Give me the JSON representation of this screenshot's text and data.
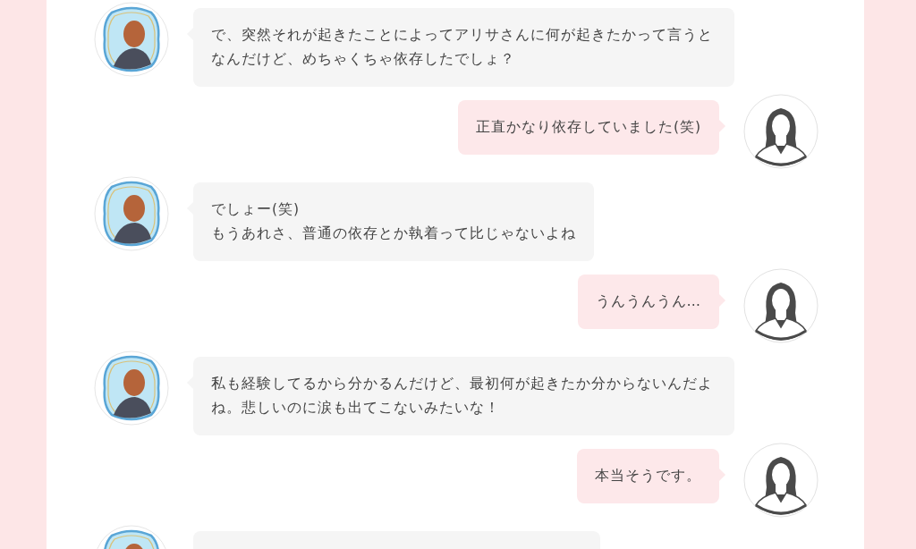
{
  "messages": [
    {
      "kind": "incoming",
      "text": "で、突然それが起きたことによってアリサさんに何が起きたかって言うとなんだけど、めちゃくちゃ依存したでしょ？"
    },
    {
      "kind": "outgoing",
      "text": "正直かなり依存していました(笑)"
    },
    {
      "kind": "incoming",
      "text": "でしょー(笑)\nもうあれさ、普通の依存とか執着って比じゃないよね"
    },
    {
      "kind": "outgoing",
      "text": "うんうんうん…"
    },
    {
      "kind": "incoming",
      "text": "私も経験してるから分かるんだけど、最初何が起きたか分からないんだよね。悲しいのに涙も出てこないみたいな！"
    },
    {
      "kind": "outgoing",
      "text": "本当そうです。"
    },
    {
      "kind": "incoming"
    }
  ]
}
